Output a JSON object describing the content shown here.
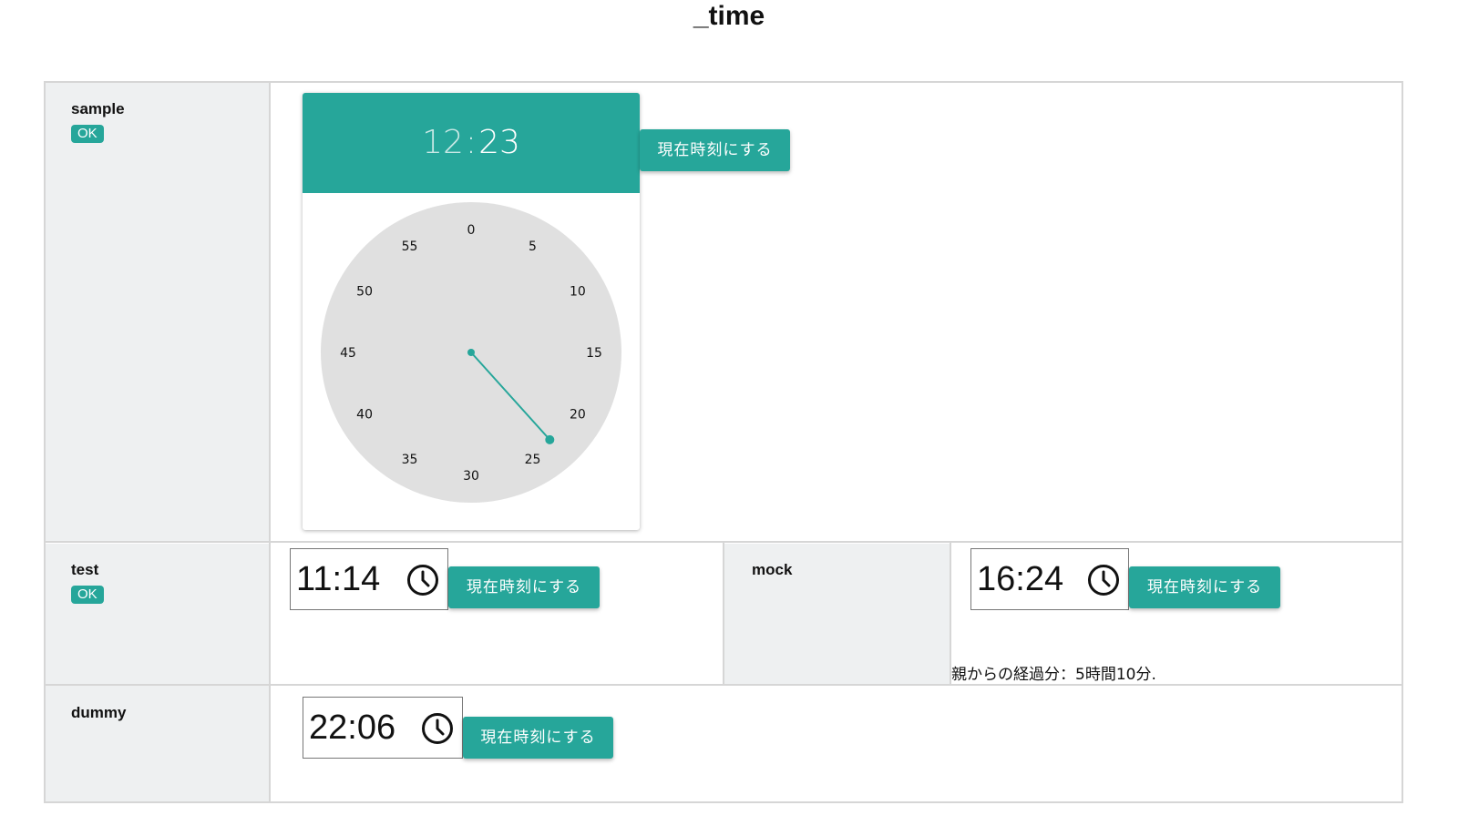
{
  "page": {
    "title": "_time"
  },
  "accent_color": "#26a69a",
  "rows": {
    "sample": {
      "label": "sample",
      "badge": "OK",
      "picker": {
        "hours": "12",
        "separator": ":",
        "minutes": "23",
        "selected_minute": 23,
        "dial_labels": [
          "0",
          "5",
          "10",
          "15",
          "20",
          "25",
          "30",
          "35",
          "40",
          "45",
          "50",
          "55"
        ]
      },
      "now_button": "現在時刻にする"
    },
    "test": {
      "label": "test",
      "badge": "OK",
      "value": "11:14",
      "now_button": "現在時刻にする"
    },
    "mock": {
      "label": "mock",
      "value": "16:24",
      "now_button": "現在時刻にする",
      "elapsed_text": "親からの経過分：5時間10分."
    },
    "dummy": {
      "label": "dummy",
      "value": "22:06",
      "now_button": "現在時刻にする"
    }
  },
  "icons": {
    "time_input_icon": "clock-icon"
  }
}
